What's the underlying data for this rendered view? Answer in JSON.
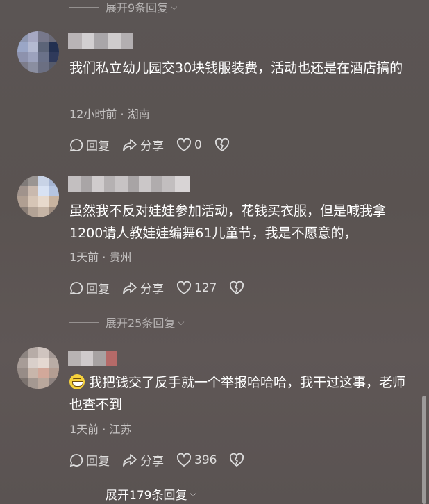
{
  "top_expand": {
    "label": "展开9条回复"
  },
  "comments": [
    {
      "text": "我们私立幼儿园交30块钱服装费，活动也还是在酒店搞的",
      "meta": "12小时前 · 湖南",
      "reply_label": "回复",
      "share_label": "分享",
      "like_count": "0"
    },
    {
      "text": "虽然我不反对娃娃参加活动，花钱买衣服，但是喊我拿1200请人教娃娃编舞61儿童节，我是不愿意的，",
      "meta": "1天前 · 贵州",
      "reply_label": "回复",
      "share_label": "分享",
      "like_count": "127",
      "expand_label": "展开25条回复"
    },
    {
      "text": "我把钱交了反手就一个举报哈哈哈，我干过这事，老师也查不到",
      "emoji": "grin-emoji",
      "meta": "1天前 · 江苏",
      "reply_label": "回复",
      "share_label": "分享",
      "like_count": "396",
      "expand_label": "展开179条回复"
    }
  ],
  "icons": {
    "reply": "comment-bubble-icon",
    "share": "share-arrow-icon",
    "like": "heart-icon",
    "dislike": "broken-heart-icon",
    "expand": "chevron-down-icon"
  }
}
